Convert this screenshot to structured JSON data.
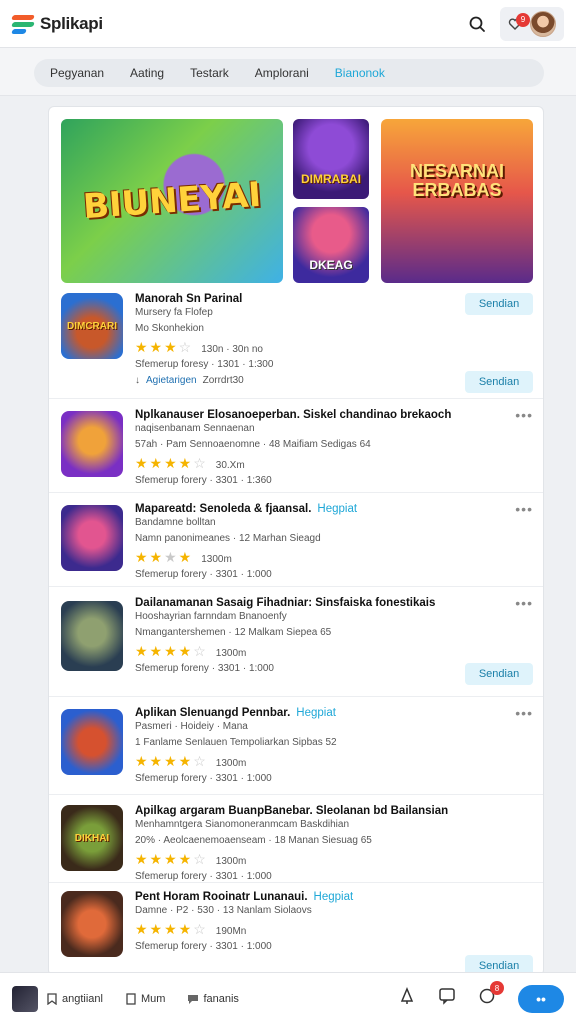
{
  "header": {
    "app_name": "Splikapi",
    "notification_count": "9"
  },
  "tabs": [
    {
      "label": "Pegyanan"
    },
    {
      "label": "Aating"
    },
    {
      "label": "Testark"
    },
    {
      "label": "Amplorani"
    },
    {
      "label": "Bianonok"
    }
  ],
  "active_tab_index": 4,
  "banners": {
    "main": "BIUNEYAI",
    "small_top": "DIMRABAI",
    "small_bottom": "DKEAG",
    "right": "NESARNAI ERBABAS"
  },
  "featured": {
    "thumb_label": "DIMCRARI",
    "title": "Manorah Sn Parinal",
    "line1": "Mursery fa Flofep",
    "line2": "Mo Skonhekion",
    "rating": "130n · 30n no",
    "meta": "Sfemerup foresy · 1301 · 1:300",
    "action_top": "Sendian",
    "sub_link": "Agietarigen",
    "sub_text": "Zorrdrt30",
    "action_bottom": "Sendian"
  },
  "apps": [
    {
      "thumb": "",
      "title": "Nplkanauser Elosanoeperban. Siskel chandinao brekaoch",
      "tag": "",
      "line1": "naqisenbanam Sennaenan",
      "line2": "57ah · Pam Sennoaenomne · 48 Maifiam Sedigas 64",
      "rating": "30.Xm",
      "meta": "Sfemerup forery · 3301 · 1:360",
      "action": ""
    },
    {
      "thumb": "",
      "title": "Mapareatd: Senoleda & fjaansal.",
      "tag": "Hegpiat",
      "line1": "Bandamne bolltan",
      "line2": "Namn panonimeanes · 12 Marhan Sieagd",
      "rating": "1300m",
      "meta": "Sfemerup forery · 3301 · 1:000",
      "action": ""
    },
    {
      "thumb": "",
      "title": "Dailanamanan Sasaig Fihadniar: Sinsfaiska fonestikais",
      "tag": "",
      "line1": "Hooshayrian farnndam Bnanoenfy",
      "line2": "Nmangantershemen · 12 Malkam Siepea 65",
      "rating": "1300m",
      "meta": "Sfemerup foreny · 3301 · 1:000",
      "action": "Sendian"
    },
    {
      "thumb": "",
      "title": "Aplikan Slenuangd Pennbar.",
      "tag": "Hegpiat",
      "line1": "Pasmeri · Hoideiy · Mana",
      "line2": "1 Fanlame Senlauen Tempoliarkan Sipbas 52",
      "rating": "1300m",
      "meta": "Sfemerup forery · 3301 · 1:000",
      "action": ""
    },
    {
      "thumb": "DIKHAI",
      "title": "Apilkag argaram BuanpBanebar. Sleolanan bd Bailansian",
      "tag": "",
      "line1": "Menhamntgera Sianomoneranmcam Baskdihian",
      "line2": "20% · Aeolcaenemoaenseam · 18 Manan Siesuag 65",
      "rating": "1300m",
      "meta": "Sfemerup forery · 3301 · 1:000",
      "action": ""
    },
    {
      "thumb": "",
      "title": "Pent Horam Rooinatr Lunanaui.",
      "tag": "Hegpiat",
      "line1": "Damne · P2 · 530 · 13 Nanlam Siolaovs",
      "line2": "",
      "rating": "190Mn",
      "meta": "Sfemerup forery · 3301 · 1:000",
      "action": "Sendian"
    }
  ],
  "bottom_bar": {
    "item1": "angtiianl",
    "item2": "Mum",
    "item3": "fananis",
    "badge_count": "8"
  },
  "colors": {
    "accent": "#1ea7d7",
    "star": "#f5b400",
    "badge": "#e53935",
    "fab": "#1e88e5"
  }
}
